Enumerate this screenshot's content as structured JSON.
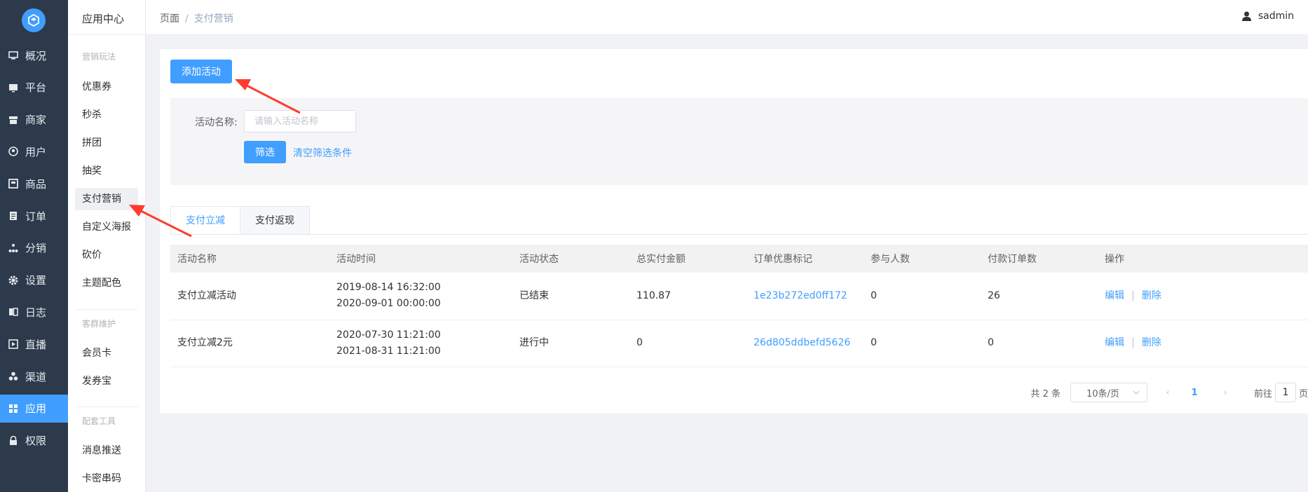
{
  "nav": {
    "items": [
      {
        "label": "概况",
        "icon": "monitor-icon"
      },
      {
        "label": "平台",
        "icon": "screen-icon"
      },
      {
        "label": "商家",
        "icon": "store-icon"
      },
      {
        "label": "用户",
        "icon": "user-circle-icon"
      },
      {
        "label": "商品",
        "icon": "product-icon"
      },
      {
        "label": "订单",
        "icon": "clipboard-icon"
      },
      {
        "label": "分销",
        "icon": "hierarchy-icon"
      },
      {
        "label": "设置",
        "icon": "gear-icon"
      },
      {
        "label": "日志",
        "icon": "book-icon"
      },
      {
        "label": "直播",
        "icon": "play-icon"
      },
      {
        "label": "渠道",
        "icon": "cluster-icon"
      },
      {
        "label": "应用",
        "icon": "grid-icon"
      },
      {
        "label": "权限",
        "icon": "lock-icon"
      }
    ],
    "active_index": 11
  },
  "subnav": {
    "title": "应用中心",
    "group1": "营销玩法",
    "group1_items": [
      "优惠券",
      "秒杀",
      "拼团",
      "抽奖",
      "支付营销",
      "自定义海报",
      "砍价",
      "主题配色"
    ],
    "active_item": "支付营销",
    "group2": "客群维护",
    "group2_items": [
      "会员卡",
      "发券宝"
    ],
    "group3": "配套工具",
    "group3_items": [
      "消息推送",
      "卡密串码"
    ]
  },
  "header": {
    "crumb_root": "页面",
    "crumb_sep": "/",
    "crumb_current": "支付营销",
    "username": "sadmin"
  },
  "toolbar": {
    "add_label": "添加活动"
  },
  "filter": {
    "name_label": "活动名称:",
    "name_placeholder": "请输入活动名称",
    "filter_label": "筛选",
    "clear_label": "清空筛选条件"
  },
  "tabs": [
    "支付立减",
    "支付返现"
  ],
  "table": {
    "columns": [
      "活动名称",
      "活动时间",
      "活动状态",
      "总实付金额",
      "订单优惠标记",
      "参与人数",
      "付款订单数",
      "操作"
    ],
    "rows": [
      {
        "name": "支付立减活动",
        "start": "2019-08-14 16:32:00",
        "end": "2020-09-01 00:00:00",
        "status": "已结束",
        "amount": "110.87",
        "tag": "1e23b272ed0ff172",
        "people": "0",
        "orders": "26"
      },
      {
        "name": "支付立减2元",
        "start": "2020-07-30 11:21:00",
        "end": "2021-08-31 11:21:00",
        "status": "进行中",
        "amount": "0",
        "tag": "26d805ddbefd5626",
        "people": "0",
        "orders": "0"
      }
    ],
    "edit_label": "编辑",
    "op_sep": "|",
    "delete_label": "删除"
  },
  "pagination": {
    "total": "共 2 条",
    "page_size": "10条/页",
    "current_page": "1",
    "goto_prefix": "前往",
    "goto_value": "1",
    "goto_suffix": "页"
  },
  "colors": {
    "primary": "#409eff",
    "nav_bg": "#2d3a4b"
  }
}
